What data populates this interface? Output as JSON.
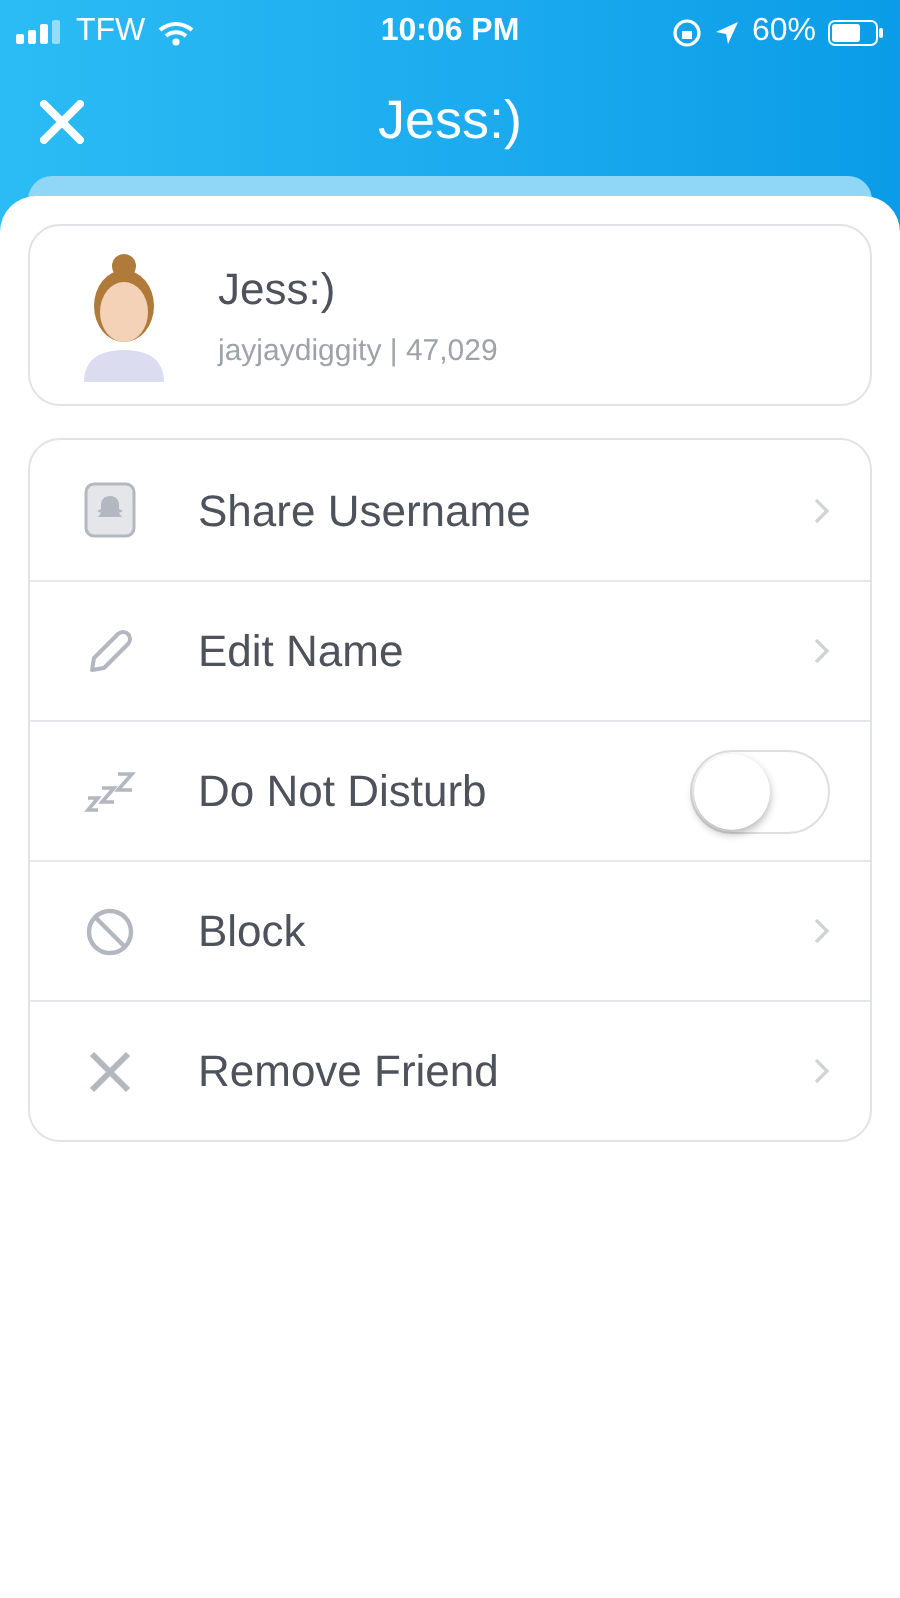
{
  "status_bar": {
    "carrier": "TFW",
    "time": "10:06 PM",
    "battery": "60%"
  },
  "header": {
    "title": "Jess:)"
  },
  "profile": {
    "name": "Jess:)",
    "subtitle": "jayjaydiggity | 47,029"
  },
  "menu": [
    {
      "kind": "link",
      "label": "Share Username"
    },
    {
      "kind": "link",
      "label": "Edit Name"
    },
    {
      "kind": "toggle",
      "label": "Do Not Disturb",
      "on": false
    },
    {
      "kind": "link",
      "label": "Block"
    },
    {
      "kind": "link",
      "label": "Remove Friend"
    }
  ]
}
